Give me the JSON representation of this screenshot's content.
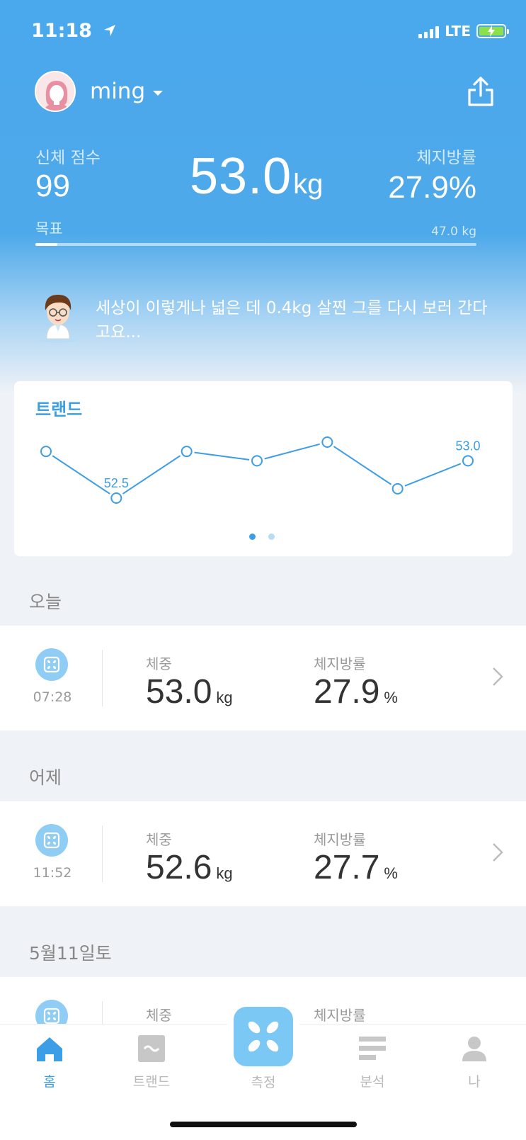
{
  "status_bar": {
    "time": "11:18",
    "network": "LTE"
  },
  "profile": {
    "username": "ming"
  },
  "summary": {
    "score_label": "신체 점수",
    "score_value": "99",
    "weight_value": "53.0",
    "weight_unit": "kg",
    "fat_label": "체지방률",
    "fat_value": "27.9%",
    "goal_label": "목표",
    "goal_target": "47.0 kg",
    "goal_progress": 0.05
  },
  "coach_message": "세상이 이렇게나 넓은 데 0.4kg 살찐 그를 다시 보러 간다고요...",
  "trend": {
    "title": "트랜드",
    "page_count": 2,
    "active_page": 0
  },
  "chart_data": {
    "type": "line",
    "series": [
      {
        "values": [
          53.0,
          52.5,
          53.0,
          52.9,
          53.1,
          52.6,
          52.9
        ]
      }
    ],
    "point_labels": [
      {
        "index": 1,
        "text": "52.5"
      },
      {
        "index": 6,
        "text": "53.0"
      }
    ]
  },
  "days": [
    {
      "label": "오늘",
      "time": "07:28",
      "weight_label": "체중",
      "weight": "53.0",
      "weight_unit": "kg",
      "fat_label": "체지방률",
      "fat": "27.9",
      "fat_unit": "%"
    },
    {
      "label": "어제",
      "time": "11:52",
      "weight_label": "체중",
      "weight": "52.6",
      "weight_unit": "kg",
      "fat_label": "체지방률",
      "fat": "27.7",
      "fat_unit": "%"
    },
    {
      "label": "5월11일토",
      "weight_label": "체중",
      "fat_label": "체지방률"
    }
  ],
  "tabs": [
    {
      "label": "홈",
      "icon": "home-icon",
      "active": true
    },
    {
      "label": "트랜드",
      "icon": "trend-icon"
    },
    {
      "label": "측정",
      "icon": "scale-icon"
    },
    {
      "label": "분석",
      "icon": "analysis-icon"
    },
    {
      "label": "나",
      "icon": "profile-icon"
    }
  ],
  "colors": {
    "accent": "#3c9ee6",
    "hero": "#4ea9ea",
    "scale_badge": "#8fcdf5"
  }
}
